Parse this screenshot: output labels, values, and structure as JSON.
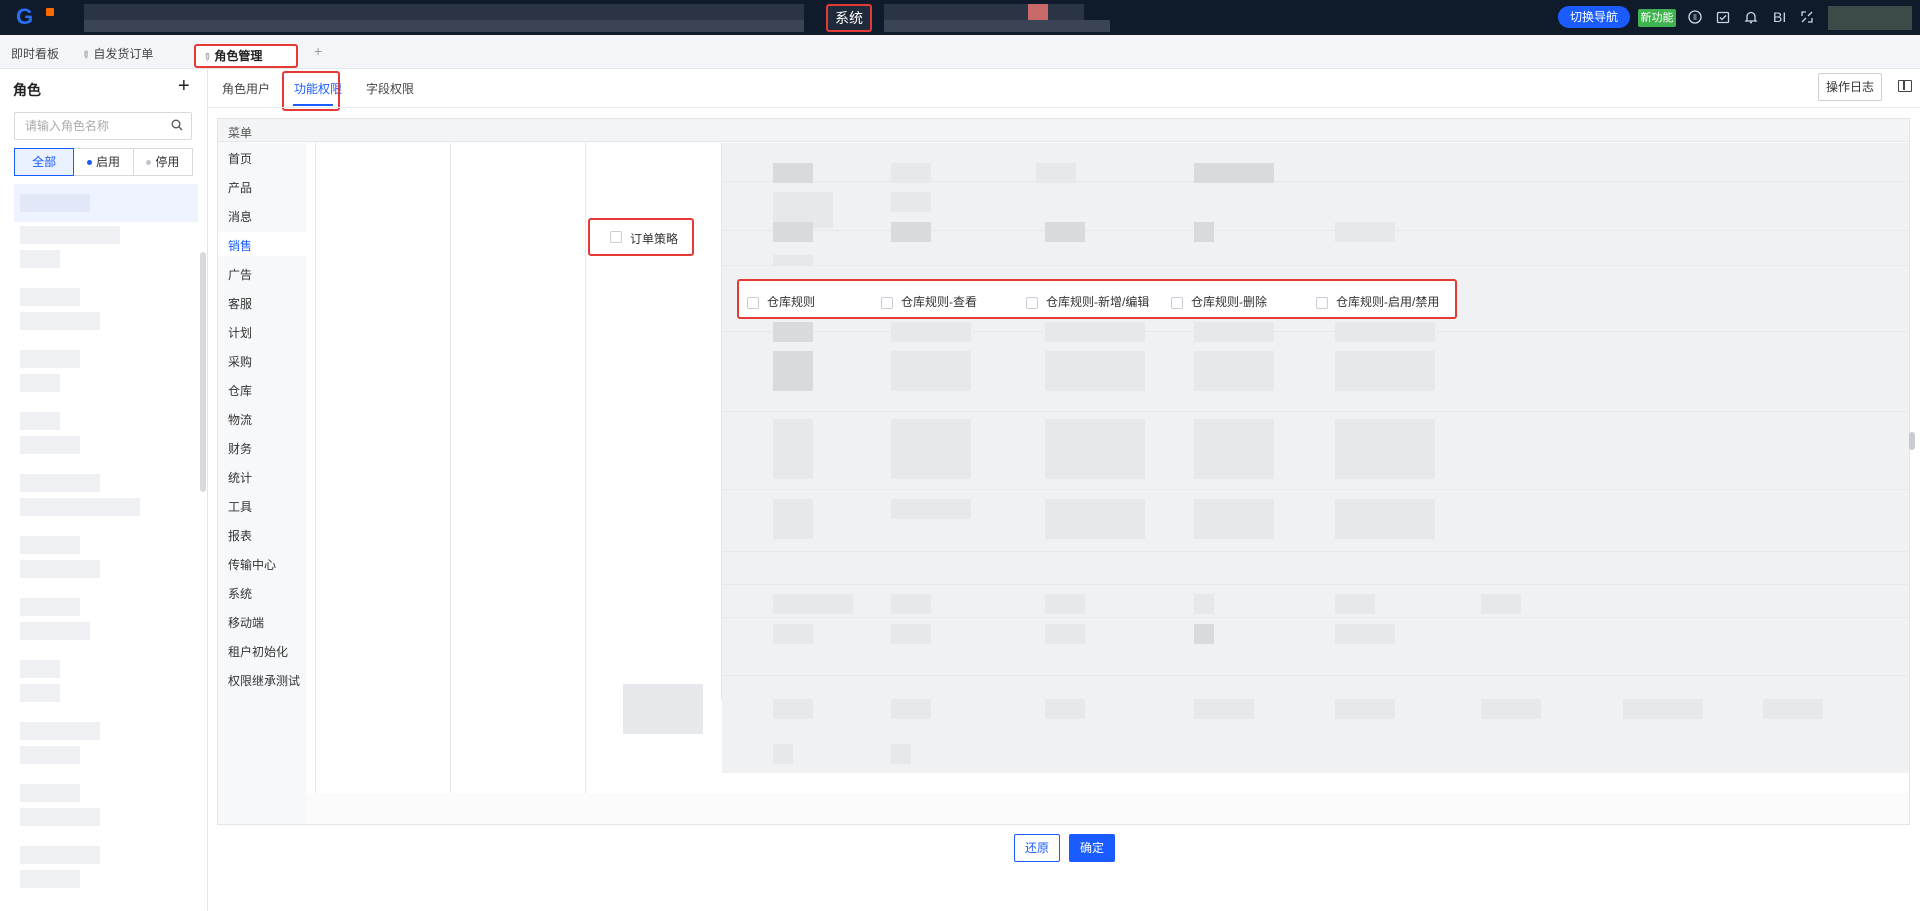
{
  "topbar": {
    "system_tab": "系统",
    "switch_nav": "切换导航",
    "new_feature": "新功能",
    "bi_label": "BI"
  },
  "page_tabs": [
    {
      "label": "即时看板"
    },
    {
      "label": "自发货订单"
    },
    {
      "label": "角色管理",
      "active": true
    }
  ],
  "add_tab": "+",
  "left_panel": {
    "title": "角色",
    "add": "+",
    "search_placeholder": "请输入角色名称",
    "filters": [
      {
        "label": "全部",
        "active": true
      },
      {
        "label": "启用",
        "dot_color": "#1a5cff"
      },
      {
        "label": "停用",
        "dot_color": "#c0c4cc"
      }
    ]
  },
  "sub_tabs": [
    {
      "label": "角色用户"
    },
    {
      "label": "功能权限",
      "active": true
    },
    {
      "label": "字段权限"
    }
  ],
  "log_button": "操作日志",
  "perm": {
    "menu_header": "菜单",
    "menu_items": [
      "首页",
      "产品",
      "消息",
      "销售",
      "广告",
      "客服",
      "计划",
      "采购",
      "仓库",
      "物流",
      "财务",
      "统计",
      "工具",
      "报表",
      "传输中心",
      "系统",
      "移动端",
      "租户初始化",
      "权限继承测试"
    ],
    "active_menu": "销售",
    "order_strategy": "订单策略",
    "warehouse_rules": [
      "仓库规则",
      "仓库规则-查看",
      "仓库规则-新增/编辑",
      "仓库规则-删除",
      "仓库规则-启用/禁用"
    ]
  },
  "actions": {
    "reset": "还原",
    "confirm": "确定"
  },
  "colors": {
    "accent": "#1a5cff",
    "highlight": "#e53935",
    "topbar_bg": "#0f1a2a",
    "new_feature_bg": "#3fb34f"
  }
}
